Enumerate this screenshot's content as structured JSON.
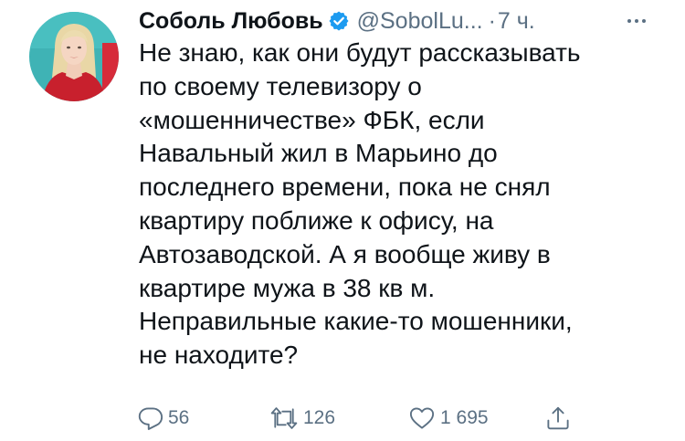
{
  "tweet": {
    "author": {
      "display_name": "Соболь Любовь",
      "verified": true,
      "handle": "@SobolLu...",
      "avatar_icon": "user-avatar-photo"
    },
    "separator": "·",
    "timestamp": "7 ч.",
    "text_lines": [
      "Не знаю, как они будут рассказывать",
      "по своему телевизору о",
      "«мошенничестве» ФБК, если",
      "Навальный жил в Марьино до",
      "последнего времени, пока не снял",
      "квартиру поближе к офису, на",
      "Автозаводской. А я вообще живу в",
      "квартире мужа в 38 кв м.",
      "Неправильные какие-то мошенники,",
      "не находите?"
    ],
    "actions": {
      "reply": {
        "icon": "reply-icon",
        "count": "56"
      },
      "retweet": {
        "icon": "retweet-icon",
        "count": "126"
      },
      "like": {
        "icon": "heart-icon",
        "count": "1 695"
      },
      "share": {
        "icon": "share-icon"
      }
    }
  },
  "colors": {
    "text_primary": "#0f1419",
    "text_secondary": "#5b7083",
    "verified_blue": "#1d9bf0",
    "avatar_background": "#3fb3b5",
    "avatar_accent_red": "#d62b3a"
  }
}
